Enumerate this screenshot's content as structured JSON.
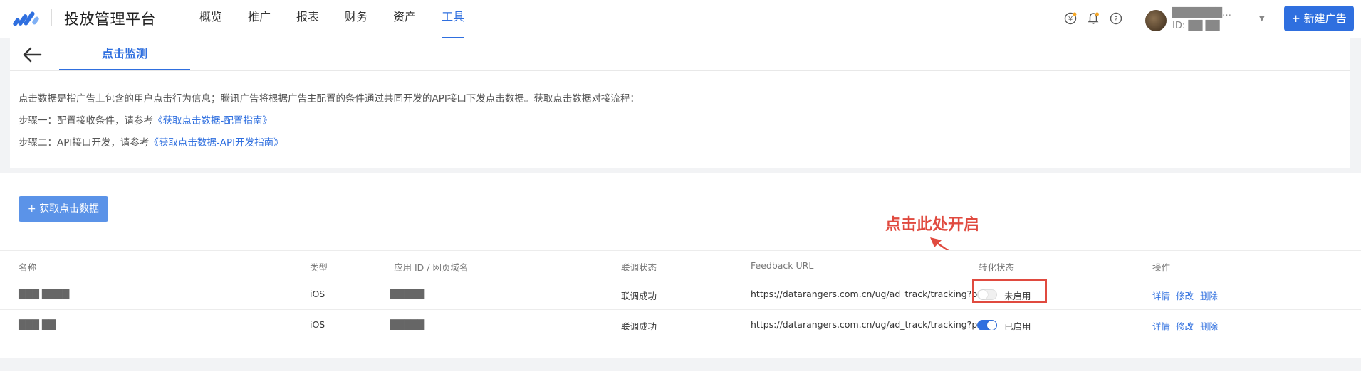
{
  "app": {
    "title": "投放管理平台"
  },
  "nav": [
    {
      "label": "概览"
    },
    {
      "label": "推广"
    },
    {
      "label": "报表"
    },
    {
      "label": "财务"
    },
    {
      "label": "资产"
    },
    {
      "label": "工具",
      "active": true
    }
  ],
  "user": {
    "name": "███████…",
    "id": "ID: ██ ██"
  },
  "header_actions": {
    "new_ad": "+ 新建广告"
  },
  "page": {
    "tab": "点击监测",
    "desc_line1": "点击数据是指广告上包含的用户点击行为信息；腾讯广告将根据广告主配置的条件通过共同开发的API接口下发点击数据。获取点击数据对接流程：",
    "step1_prefix": "步骤一：配置接收条件，请参考",
    "step1_link": "《获取点击数据-配置指南》",
    "step2_prefix": "步骤二：API接口开发，请参考",
    "step2_link": "《获取点击数据-API开发指南》",
    "get_button": "+ 获取点击数据"
  },
  "annotation": {
    "text": "点击此处开启",
    "color": "#e04a3f"
  },
  "table": {
    "columns": [
      "名称",
      "类型",
      "应用 ID / 网页域名",
      "联调状态",
      "Feedback URL",
      "转化状态",
      "操作"
    ],
    "rows": [
      {
        "name": "███ ████",
        "type": "iOS",
        "app_id": "█████",
        "debug_status": "联调成功",
        "feedback_url": "https://datarangers.com.cn/ug/ad_track/tracking?p...",
        "conversion_enabled": false,
        "conversion_label": "未启用",
        "actions": [
          "详情",
          "修改",
          "删除"
        ]
      },
      {
        "name": "███ ██",
        "type": "iOS",
        "app_id": "█████",
        "debug_status": "联调成功",
        "feedback_url": "https://datarangers.com.cn/ug/ad_track/tracking?p...",
        "conversion_enabled": true,
        "conversion_label": "已启用",
        "actions": [
          "详情",
          "修改",
          "删除"
        ]
      }
    ]
  },
  "colors": {
    "accent": "#2f6fdf",
    "annotation": "#e04a3f",
    "button": "#5b93e8"
  },
  "icons": [
    "logo-icon",
    "coin-icon",
    "bell-icon",
    "help-icon",
    "back-arrow-icon"
  ]
}
